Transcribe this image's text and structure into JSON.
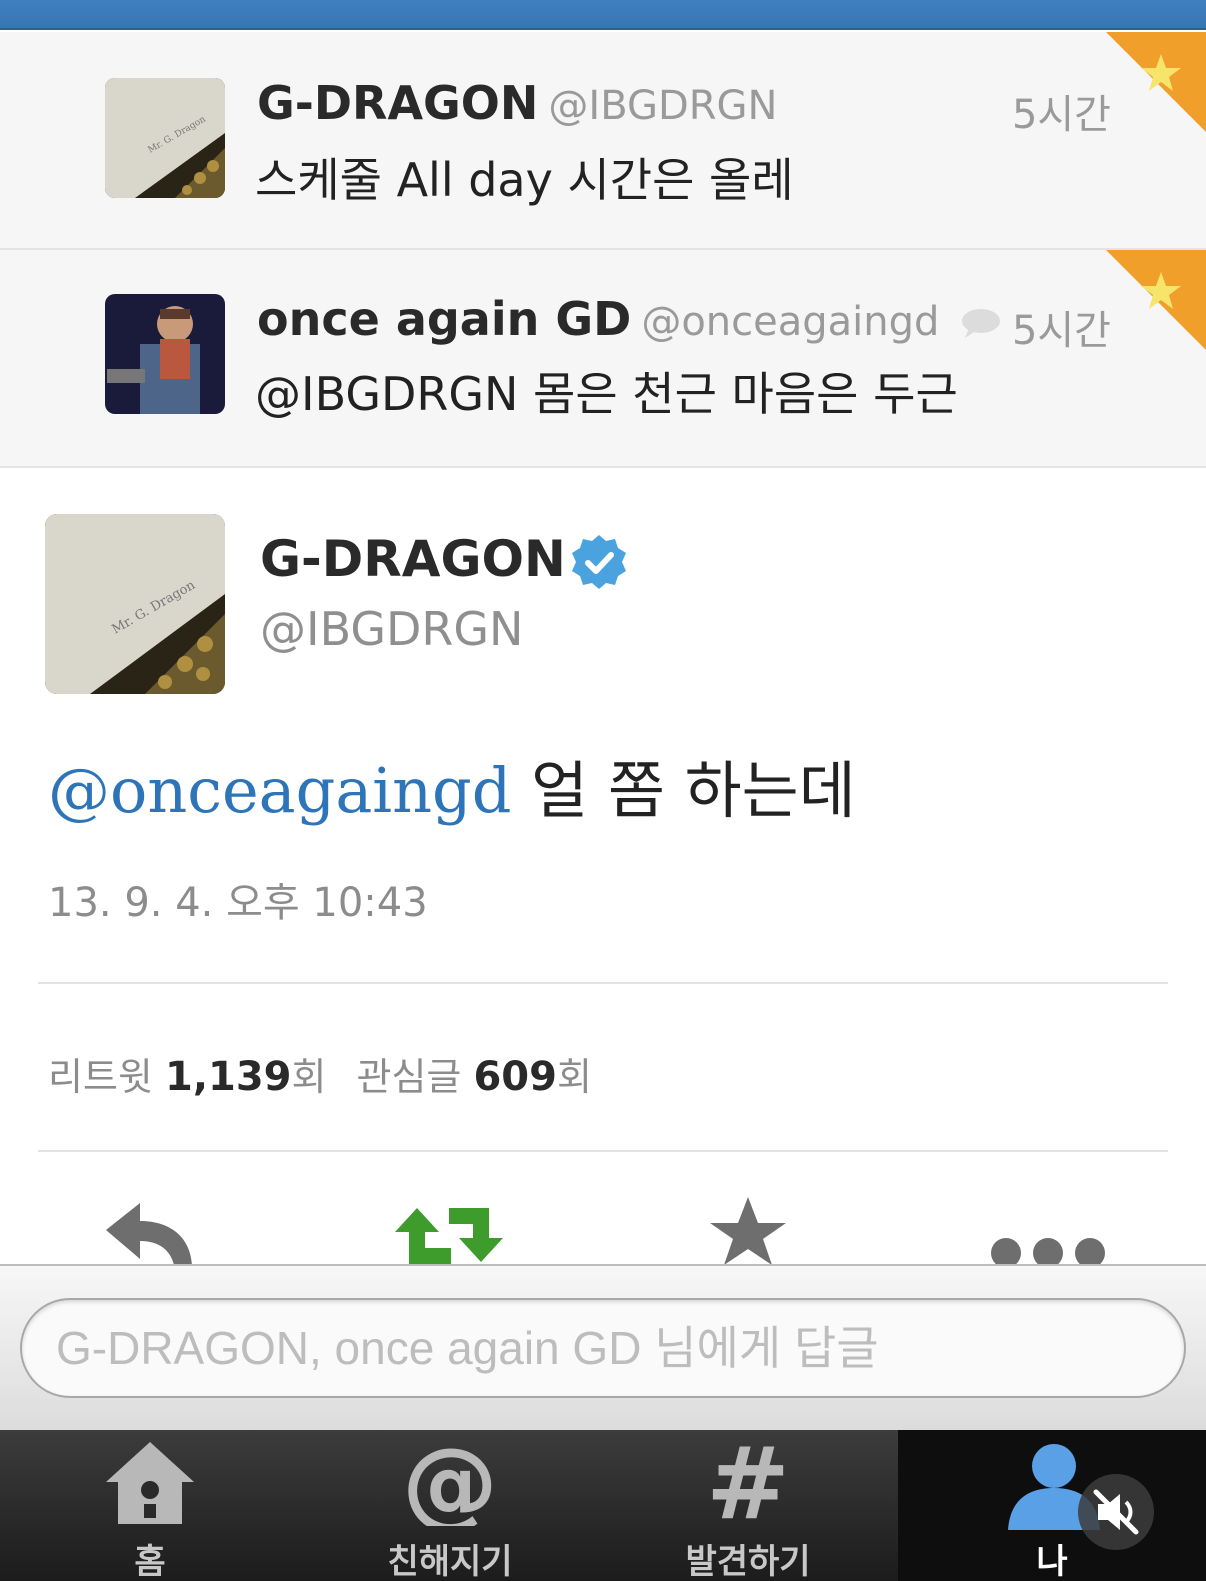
{
  "timeline": [
    {
      "name": "G-DRAGON",
      "handle": "@IBGDRGN",
      "time": "5시간",
      "text": "스케줄 All day 시간은 올레",
      "has_reply_icon": false
    },
    {
      "name": "once again GD",
      "handle": "@onceagaingd",
      "time": "5시간",
      "text": "@IBGDRGN 몸은 천근 마음은 두근",
      "has_reply_icon": true
    }
  ],
  "detail": {
    "name": "G-DRAGON",
    "handle": "@IBGDRGN",
    "mention": "@onceagaingd",
    "text": " 얼 쫌 하는데",
    "timestamp": "13. 9. 4. 오후 10:43",
    "retweet_label": "리트윗",
    "retweet_count": "1,139",
    "retweet_unit": "회",
    "fav_label": "관심글",
    "fav_count": "609",
    "fav_unit": "회"
  },
  "actions": [
    "reply-icon",
    "retweet-icon",
    "favorite-icon",
    "more-icon"
  ],
  "reply": {
    "placeholder": "G-DRAGON, once again GD 님에게 답글"
  },
  "tabs": [
    {
      "label": "홈",
      "icon": "home-icon",
      "active": false
    },
    {
      "label": "친해지기",
      "icon": "at-icon",
      "active": false
    },
    {
      "label": "발견하기",
      "icon": "hashtag-icon",
      "active": false
    },
    {
      "label": "나",
      "icon": "person-icon",
      "active": true
    }
  ],
  "colors": {
    "top_bar": "#3f7fc0",
    "mention": "#2e74b8",
    "verified": "#4aa3df",
    "retweet_green": "#3e9c2c",
    "favorite_corner": "#f0a02a"
  }
}
